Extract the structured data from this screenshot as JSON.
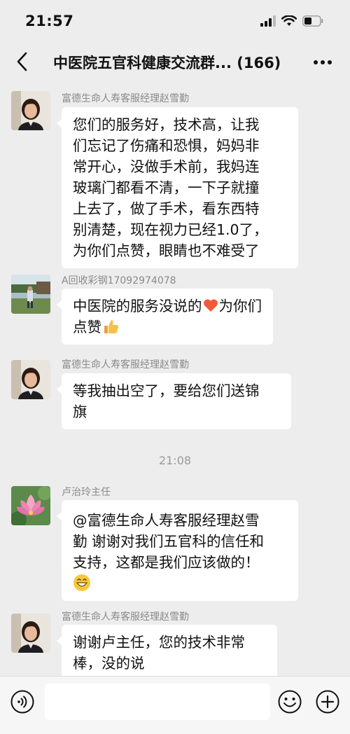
{
  "status": {
    "time": "21:57"
  },
  "header": {
    "title": "中医院五官科健康交流群... (166)"
  },
  "messages": [
    {
      "sender": "富德生命人寿客服经理赵雪勤",
      "lines": [
        "您们的服务好，技术高，让我",
        "们忘记了伤痛和恐惧，妈妈非",
        "常开心，没做手术前，我妈连",
        "玻璃门都看不清，一下子就撞",
        "上去了，做了手术，看东西特",
        "别清楚，现在视力已经1.0了，",
        "为你们点赞，眼睛也不难受了"
      ]
    },
    {
      "sender": "A回收彩钢17092974078",
      "lines": [
        "中医院的服务没说的",
        "为你们",
        "点赞"
      ],
      "emoji": [
        "heart",
        "thumbs-up"
      ]
    },
    {
      "sender": "富德生命人寿客服经理赵雪勤",
      "lines": [
        "等我抽出空了，要给您们送锦",
        "旗"
      ]
    },
    {
      "sender": "卢治玲主任",
      "lines": [
        "@富德生命人寿客服经理赵雪",
        "勤 谢谢对我们五官科的信任和",
        "支持，这都是我们应该做的！"
      ],
      "emoji": [
        "grin"
      ]
    },
    {
      "sender": "富德生命人寿客服经理赵雪勤",
      "lines": [
        "谢谢卢主任，您的技术非常",
        "棒，没的说"
      ]
    }
  ],
  "time_separator": "21:08",
  "input": {
    "value": ""
  },
  "colors": {
    "background": "#ededed",
    "bubble": "#ffffff",
    "meta_text": "#8a8a8a"
  }
}
